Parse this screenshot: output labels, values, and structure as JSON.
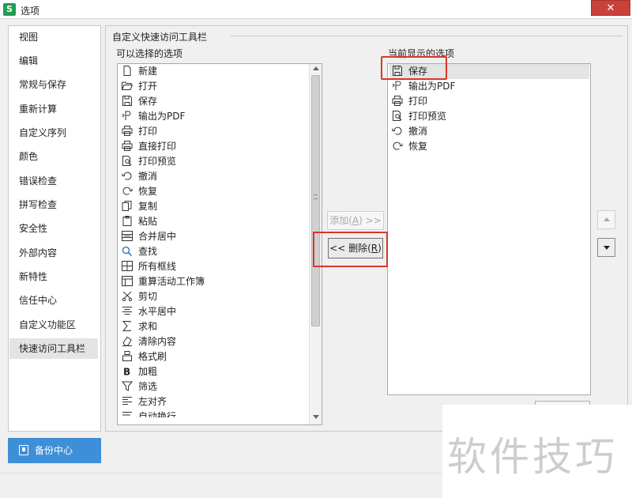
{
  "window": {
    "title": "选项",
    "app_logo": "S",
    "close": "✕"
  },
  "sidebar": {
    "items": [
      {
        "label": "视图"
      },
      {
        "label": "编辑"
      },
      {
        "label": "常规与保存"
      },
      {
        "label": "重新计算"
      },
      {
        "label": "自定义序列"
      },
      {
        "label": "颜色"
      },
      {
        "label": "错误检查"
      },
      {
        "label": "拼写检查"
      },
      {
        "label": "安全性"
      },
      {
        "label": "外部内容"
      },
      {
        "label": "新特性"
      },
      {
        "label": "信任中心"
      },
      {
        "label": "自定义功能区"
      },
      {
        "label": "快速访问工具栏"
      }
    ],
    "active": "快速访问工具栏",
    "backup_button": "备份中心"
  },
  "main": {
    "group_title": "自定义快速访问工具栏",
    "available_label": "可以选择的选项",
    "current_label": "当前显示的选项",
    "available_items": [
      {
        "label": "新建",
        "icon": "new-doc-icon"
      },
      {
        "label": "打开",
        "icon": "folder-open-icon"
      },
      {
        "label": "保存",
        "icon": "save-icon"
      },
      {
        "label": "输出为PDF",
        "icon": "pdf-export-icon"
      },
      {
        "label": "打印",
        "icon": "printer-icon"
      },
      {
        "label": "直接打印",
        "icon": "direct-print-icon"
      },
      {
        "label": "打印预览",
        "icon": "print-preview-icon"
      },
      {
        "label": "撤消",
        "icon": "undo-icon"
      },
      {
        "label": "恢复",
        "icon": "redo-icon"
      },
      {
        "label": "复制",
        "icon": "copy-icon"
      },
      {
        "label": "粘贴",
        "icon": "paste-icon"
      },
      {
        "label": "合并居中",
        "icon": "merge-center-icon"
      },
      {
        "label": "查找",
        "icon": "search-icon"
      },
      {
        "label": "所有框线",
        "icon": "all-borders-icon"
      },
      {
        "label": "重算活动工作簿",
        "icon": "recalc-icon"
      },
      {
        "label": "剪切",
        "icon": "scissors-icon"
      },
      {
        "label": "水平居中",
        "icon": "align-center-icon"
      },
      {
        "label": "求和",
        "icon": "sum-icon"
      },
      {
        "label": "清除内容",
        "icon": "eraser-icon"
      },
      {
        "label": "格式刷",
        "icon": "format-painter-icon"
      },
      {
        "label": "加粗",
        "icon": "bold-icon"
      },
      {
        "label": "筛选",
        "icon": "filter-icon"
      },
      {
        "label": "左对齐",
        "icon": "align-left-icon"
      },
      {
        "label": "自动换行",
        "icon": "wrap-text-icon"
      }
    ],
    "current_items": [
      {
        "label": "保存",
        "icon": "save-icon"
      },
      {
        "label": "输出为PDF",
        "icon": "pdf-export-icon"
      },
      {
        "label": "打印",
        "icon": "printer-icon"
      },
      {
        "label": "打印预览",
        "icon": "print-preview-icon"
      },
      {
        "label": "撤消",
        "icon": "undo-icon"
      },
      {
        "label": "恢复",
        "icon": "redo-icon"
      }
    ],
    "current_selected": "保存",
    "add_button": {
      "text": "添加(",
      "key": "A",
      "tail": ") >>"
    },
    "remove_button": {
      "text": "<< 删除(",
      "key": "R",
      "tail": ")"
    }
  },
  "watermark": "软件技巧",
  "colors": {
    "highlight": "#d9362a",
    "backup_button": "#3f8fd8",
    "app_logo": "#1f9d55",
    "close": "#c9413a"
  }
}
